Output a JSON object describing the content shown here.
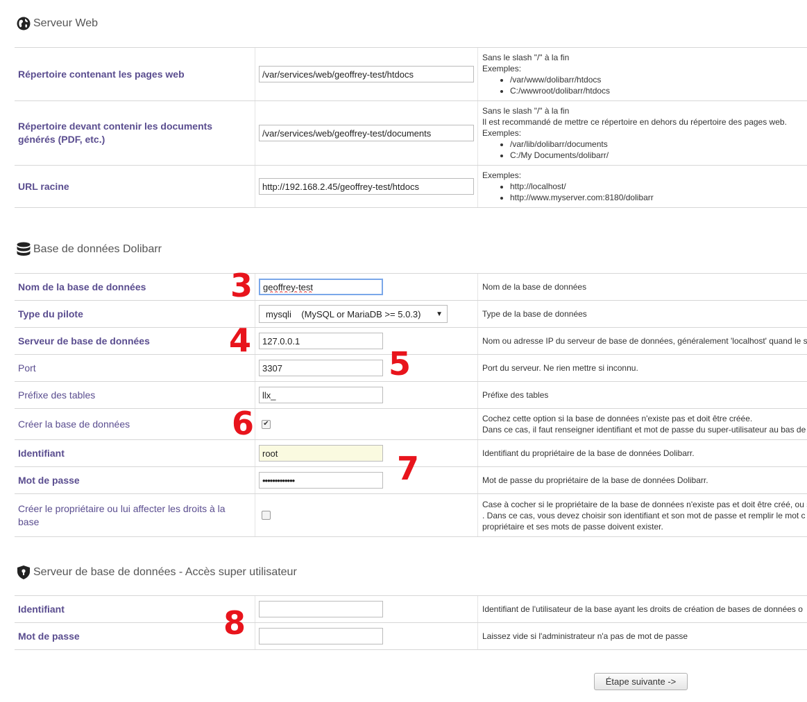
{
  "web_server": {
    "title": "Serveur Web",
    "rows": [
      {
        "label": "Répertoire contenant les pages web",
        "value": "/var/services/web/geoffrey-test/htdocs",
        "help_lines": [
          "Sans le slash \"/\" à la fin",
          "Exemples:"
        ],
        "help_items": [
          "/var/www/dolibarr/htdocs",
          "C:/wwwroot/dolibarr/htdocs"
        ]
      },
      {
        "label": "Répertoire devant contenir les documents générés (PDF, etc.)",
        "value": "/var/services/web/geoffrey-test/documents",
        "help_lines": [
          "Sans le slash \"/\" à la fin",
          "Il est recommandé de mettre ce répertoire en dehors du répertoire des pages web.",
          "Exemples:"
        ],
        "help_items": [
          "/var/lib/dolibarr/documents",
          "C:/My Documents/dolibarr/"
        ]
      },
      {
        "label": "URL racine",
        "value": "http://192.168.2.45/geoffrey-test/htdocs",
        "help_lines": [
          "Exemples:"
        ],
        "help_items": [
          "http://localhost/",
          "http://www.myserver.com:8180/dolibarr"
        ]
      }
    ]
  },
  "database": {
    "title": "Base de données Dolibarr",
    "rows": {
      "db_name": {
        "label": "Nom de la base de données",
        "value": "geoffrey-test",
        "help": "Nom de la base de données"
      },
      "driver": {
        "label": "Type du pilote",
        "value": "mysqli    (MySQL or MariaDB >= 5.0.3)",
        "help": "Type de la base de données"
      },
      "server": {
        "label": "Serveur de base de données",
        "value": "127.0.0.1",
        "help": "Nom ou adresse IP du serveur de base de données, généralement 'localhost' quand le s"
      },
      "port": {
        "label": "Port",
        "value": "3307",
        "help": "Port du serveur. Ne rien mettre si inconnu."
      },
      "prefix": {
        "label": "Préfixe des tables",
        "value": "llx_",
        "help": "Préfixe des tables"
      },
      "create_db": {
        "label": "Créer la base de données",
        "checked": true,
        "help_lines": [
          "Cochez cette option si la base de données n'existe pas et doit être créée.",
          "Dans ce cas, il faut renseigner identifiant et mot de passe du super-utilisateur au bas de"
        ]
      },
      "login": {
        "label": "Identifiant",
        "value": "root",
        "help": "Identifiant du propriétaire de la base de données Dolibarr."
      },
      "password": {
        "label": "Mot de passe",
        "value": "•••••••••••••",
        "help": "Mot de passe du propriétaire de la base de données Dolibarr."
      },
      "create_owner": {
        "label": "Créer le propriétaire ou lui affecter les droits à la base",
        "checked": false,
        "help_lines": [
          "Case à cocher si le propriétaire de la base de données n'existe pas et doit être créé, ou s",
          ". Dans ce cas, vous devez choisir son identifiant et son mot de passe et remplir le mot c",
          "propriétaire et ses mots de passe doivent exister."
        ]
      }
    }
  },
  "superuser": {
    "title": "Serveur de base de données - Accès super utilisateur",
    "rows": {
      "login": {
        "label": "Identifiant",
        "value": "",
        "help": "Identifiant de l'utilisateur de la base ayant les droits de création de bases de données o"
      },
      "password": {
        "label": "Mot de passe",
        "value": "",
        "help": "Laissez vide si l'administrateur n'a pas de mot de passe"
      }
    }
  },
  "annotations": [
    "3",
    "4",
    "5",
    "6",
    "7",
    "8"
  ],
  "next_button": "Étape suivante ->",
  "colors": {
    "label": "#5a4d8f",
    "annotation": "#e8141c",
    "focus_border": "#7aa7e9"
  },
  "icons": {
    "web_server": "globe-icon",
    "database": "database-icon",
    "superuser": "shield-lock-icon"
  }
}
